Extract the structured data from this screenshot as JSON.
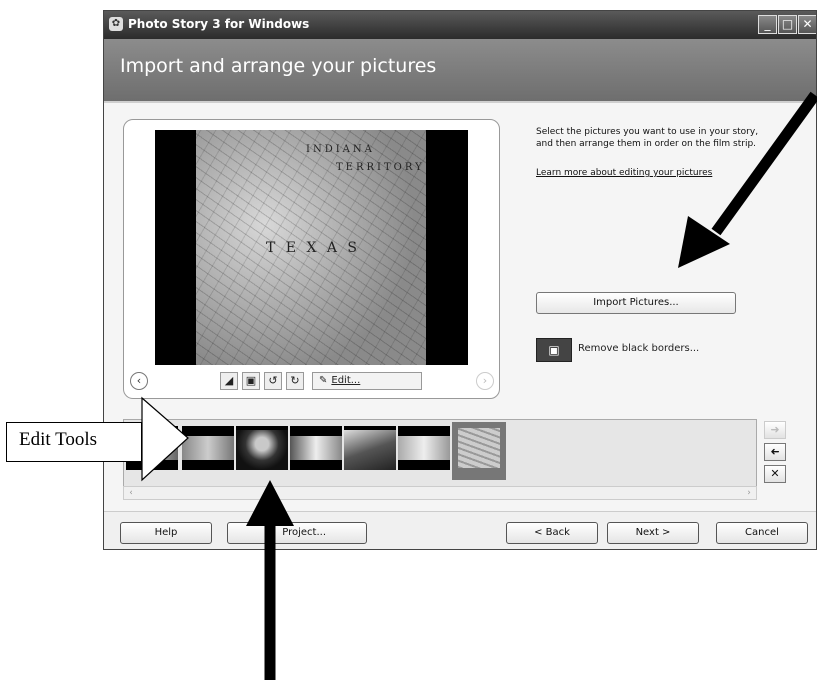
{
  "window": {
    "title": "Photo Story 3 for Windows",
    "app_icon": "photo-story-icon",
    "controls": {
      "minimize": "_",
      "maximize": "□",
      "close": "✕"
    }
  },
  "header": {
    "heading": "Import and arrange your pictures"
  },
  "preview": {
    "map_labels": {
      "indiana": "INDIANA",
      "territory": "TERRITORY",
      "texas": "T E X A S"
    },
    "toolbar": {
      "prev_icon": "‹",
      "next_icon": "›",
      "tools": [
        {
          "name": "correct-colors-icon",
          "glyph": "◢"
        },
        {
          "name": "red-eye-icon",
          "glyph": "▣"
        },
        {
          "name": "rotate-left-icon",
          "glyph": "↺"
        },
        {
          "name": "rotate-right-icon",
          "glyph": "↻"
        }
      ],
      "edit_label": "Edit...",
      "edit_icon": "✎"
    }
  },
  "instructions": {
    "line1": "Select the pictures you want to use in your story,",
    "line2": "and then arrange them in order on the film strip.",
    "learn_more": "Learn more about editing your pictures"
  },
  "import_button": "Import Pictures...",
  "remove_borders": {
    "icon": "▣",
    "label": "Remove black borders..."
  },
  "filmstrip": {
    "side_buttons": {
      "move_right": "➜",
      "move_left": "➜",
      "delete": "✕"
    }
  },
  "scroll": {
    "left": "‹",
    "right": "›"
  },
  "bottom_buttons": {
    "help": "Help",
    "save_project": "Project...",
    "back": "< Back",
    "next": "Next >",
    "cancel": "Cancel"
  },
  "annotation": {
    "edit_tools": "Edit Tools"
  },
  "colors": {
    "titlebar": "#3a3a3a",
    "header": "#7f7f7f",
    "window_bg": "#f5f5f5"
  }
}
